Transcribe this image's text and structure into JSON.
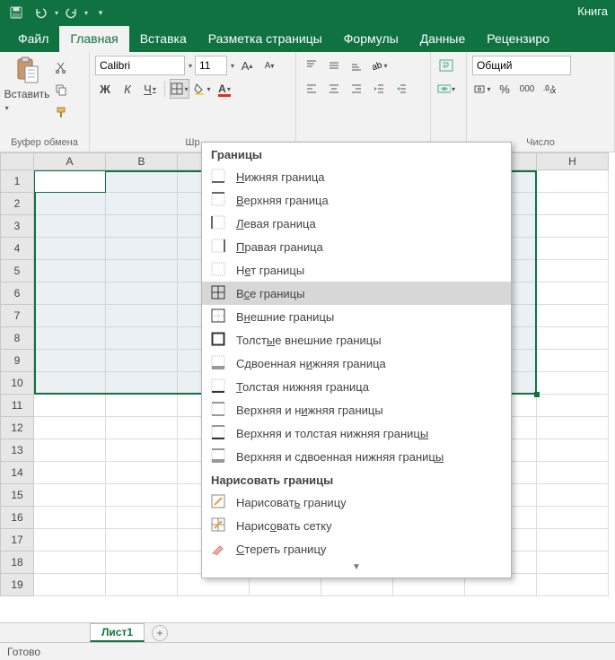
{
  "title": "Книга",
  "qat": {
    "save": "save",
    "undo": "undo",
    "redo": "redo"
  },
  "tabs": [
    "Файл",
    "Главная",
    "Вставка",
    "Разметка страницы",
    "Формулы",
    "Данные",
    "Рецензиро"
  ],
  "active_tab": 1,
  "groups": {
    "clipboard": {
      "label": "Буфер обмена",
      "paste": "Вставить"
    },
    "font": {
      "label": "Шр",
      "name": "Calibri",
      "size": "11",
      "bold": "Ж",
      "italic": "К",
      "underline": "Ч"
    },
    "number": {
      "label": "Число",
      "format": "Общий",
      "percent": "%",
      "thousands": "000"
    }
  },
  "columns": [
    "A",
    "B",
    "",
    "",
    "",
    "",
    "",
    "H"
  ],
  "rows": [
    "1",
    "2",
    "3",
    "4",
    "5",
    "6",
    "7",
    "8",
    "9",
    "10",
    "11",
    "12",
    "13",
    "14",
    "15",
    "16",
    "17",
    "18",
    "19"
  ],
  "sheet_tab": "Лист1",
  "status": "Готово",
  "menu": {
    "header1": "Границы",
    "items1": [
      {
        "u": "Н",
        "rest": "ижняя граница"
      },
      {
        "u": "В",
        "rest": "ерхняя граница"
      },
      {
        "u": "Л",
        "rest": "евая граница"
      },
      {
        "u": "П",
        "rest": "равая граница"
      },
      {
        "pre": "Н",
        "u": "е",
        "rest": "т границы"
      },
      {
        "pre": "В",
        "u": "с",
        "rest": "е границы",
        "hl": true
      },
      {
        "pre": "В",
        "u": "н",
        "rest": "ешние границы"
      },
      {
        "pre": "Толст",
        "u": "ы",
        "rest": "е внешние границы"
      },
      {
        "pre": "Сдвоенная н",
        "u": "и",
        "rest": "жняя граница"
      },
      {
        "u": "Т",
        "rest": "олстая нижняя граница"
      },
      {
        "pre": "Верхняя и н",
        "u": "и",
        "rest": "жняя границы"
      },
      {
        "pre": "Верхняя и толстая нижняя границ",
        "u": "ы",
        "rest": ""
      },
      {
        "pre": "Верхняя и сдвоенная нижняя границ",
        "u": "ы",
        "rest": ""
      }
    ],
    "header2": "Нарисовать границы",
    "items2": [
      {
        "pre": "Нарисоват",
        "u": "ь",
        "rest": " границу"
      },
      {
        "pre": "Нарис",
        "u": "о",
        "rest": "вать сетку"
      },
      {
        "u": "С",
        "rest": "тереть границу"
      }
    ]
  }
}
